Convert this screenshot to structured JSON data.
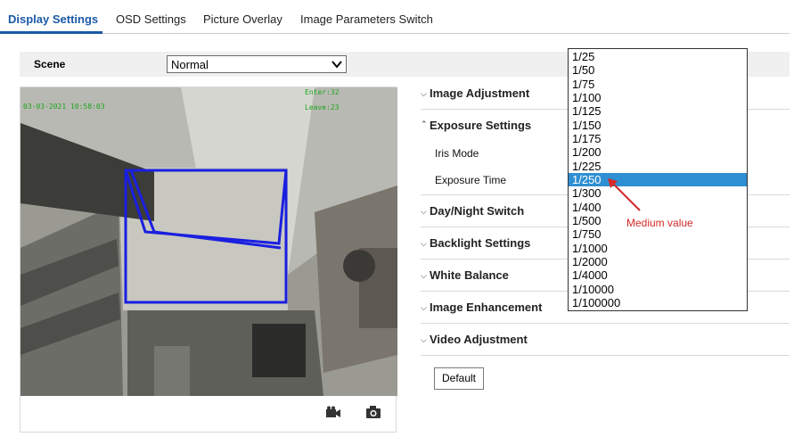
{
  "tabs": [
    {
      "label": "Display Settings",
      "active": true
    },
    {
      "label": "OSD Settings",
      "active": false
    },
    {
      "label": "Picture Overlay",
      "active": false
    },
    {
      "label": "Image Parameters Switch",
      "active": false
    }
  ],
  "scene": {
    "label": "Scene",
    "value": "Normal"
  },
  "video": {
    "osd": {
      "enter": "Enter:32",
      "leave": "Leave:23",
      "timestamp": "03-03-2021 10:58:03"
    },
    "colors": {
      "region_outline": "#1a1fe0",
      "osd_text": "#1fa51f"
    }
  },
  "sections": [
    {
      "label": "Image Adjustment",
      "expanded": false
    },
    {
      "label": "Exposure Settings",
      "expanded": true
    },
    {
      "label": "Day/Night Switch",
      "expanded": false
    },
    {
      "label": "Backlight Settings",
      "expanded": false
    },
    {
      "label": "White Balance",
      "expanded": false
    },
    {
      "label": "Image Enhancement",
      "expanded": false
    },
    {
      "label": "Video Adjustment",
      "expanded": false
    }
  ],
  "exposure": {
    "iris_mode_label": "Iris Mode",
    "exposure_time_label": "Exposure Time"
  },
  "exposure_time_options": [
    "1/25",
    "1/50",
    "1/75",
    "1/100",
    "1/125",
    "1/150",
    "1/175",
    "1/200",
    "1/225",
    "1/250",
    "1/300",
    "1/400",
    "1/500",
    "1/750",
    "1/1000",
    "1/2000",
    "1/4000",
    "1/10000",
    "1/100000"
  ],
  "exposure_time_selected": "1/250",
  "annotation": {
    "text": "Medium value",
    "color": "#d42a2a"
  },
  "default_button": "Default",
  "accent_color": "#1c5aa8",
  "selection_color": "#2f8fd3"
}
